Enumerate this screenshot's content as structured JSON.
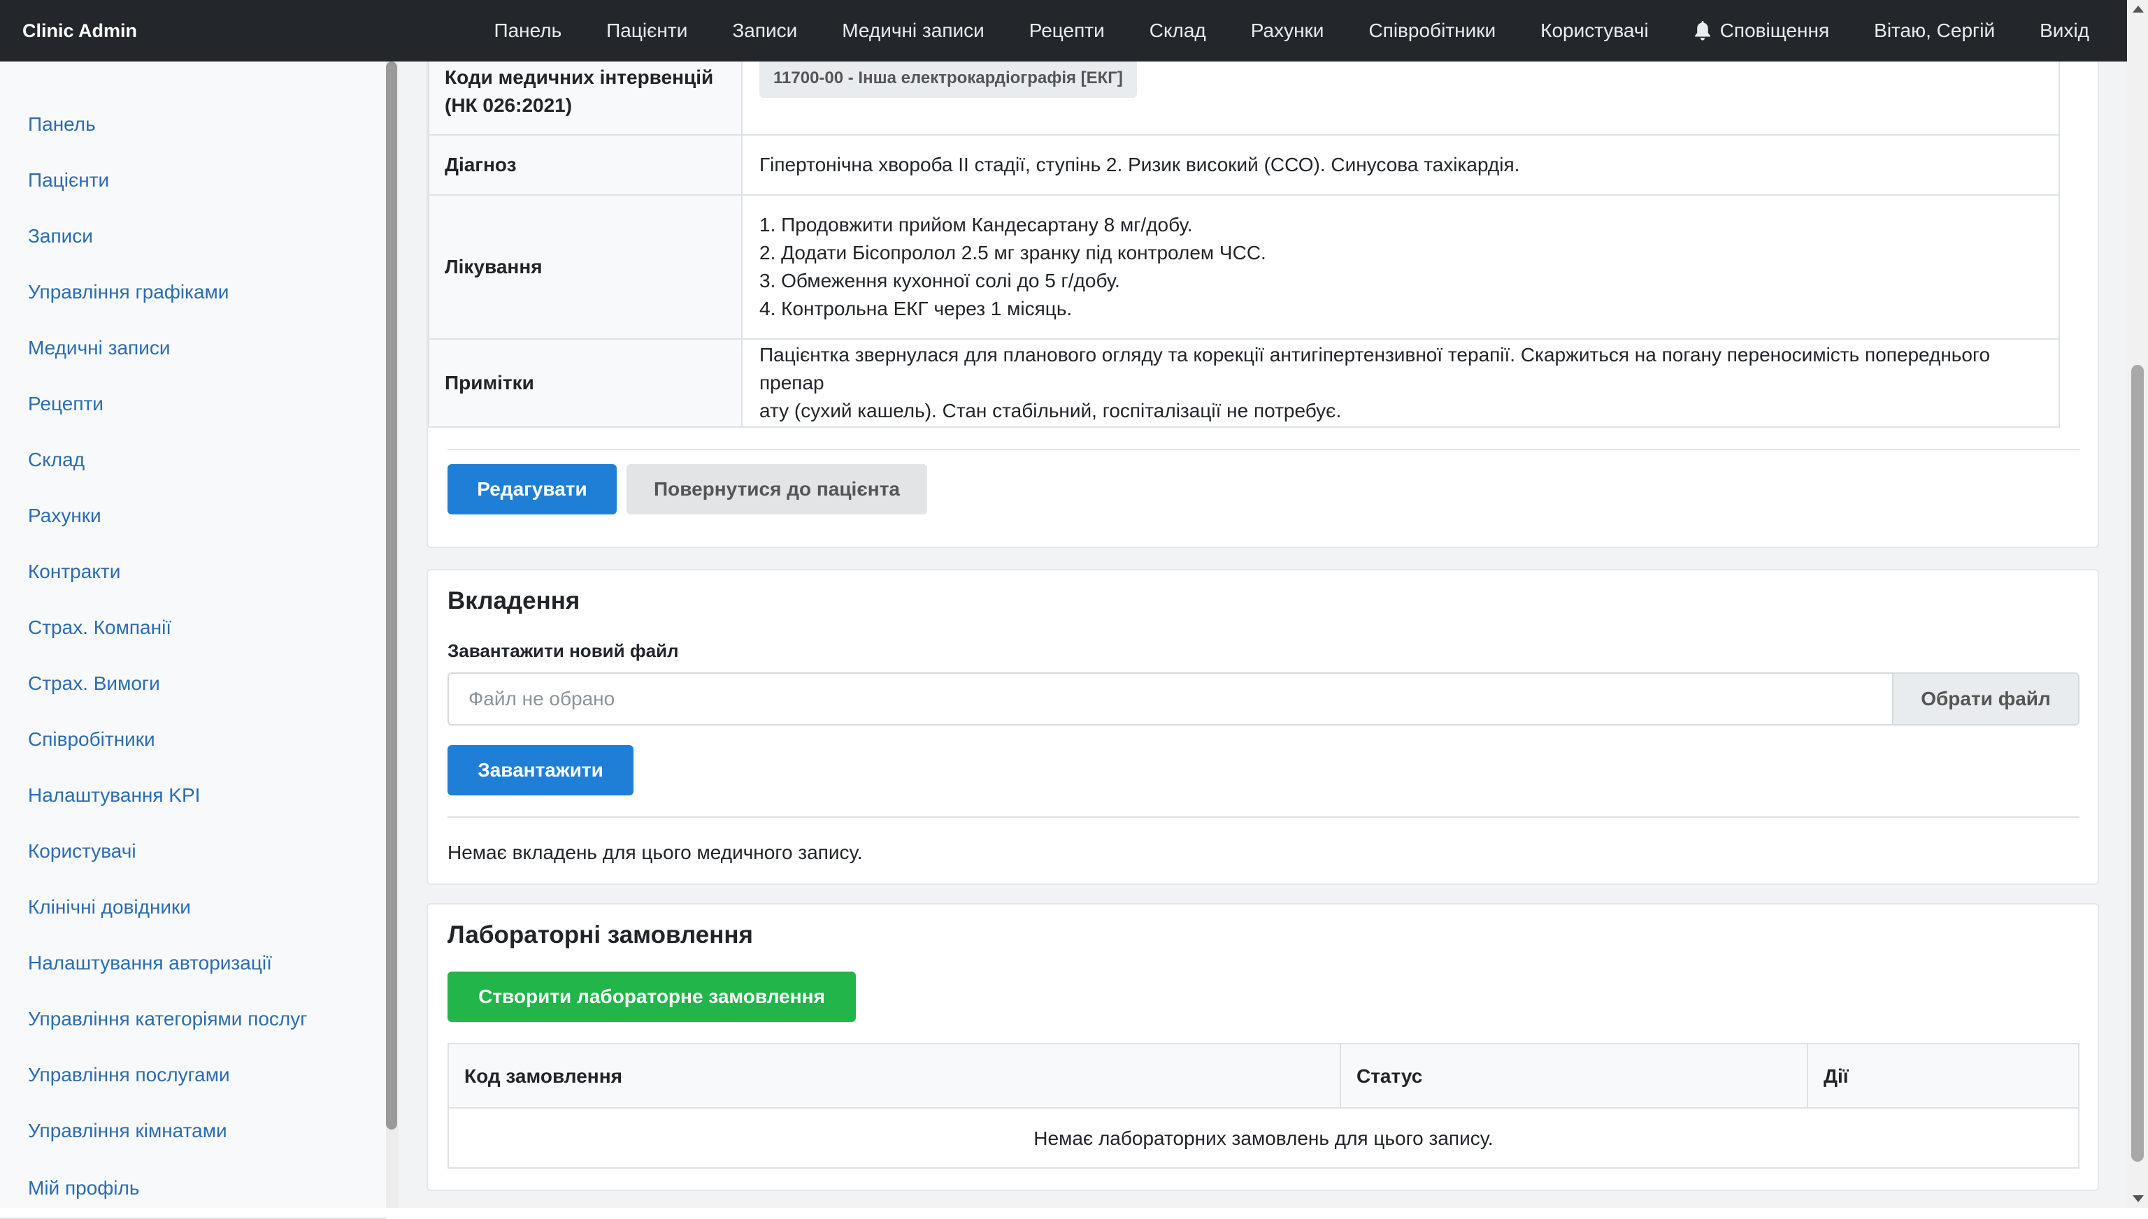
{
  "app": {
    "brand": "Clinic Admin"
  },
  "topnav": {
    "items": [
      "Панель",
      "Пацієнти",
      "Записи",
      "Медичні записи",
      "Рецепти",
      "Склад",
      "Рахунки",
      "Співробітники",
      "Користувачі"
    ],
    "notifications": "Сповіщення",
    "greeting": "Вітаю, Сергій",
    "logout": "Вихід"
  },
  "sidebar": {
    "items": [
      "Панель",
      "Пацієнти",
      "Записи",
      "Управління графіками",
      "Медичні записи",
      "Рецепти",
      "Склад",
      "Рахунки",
      "Контракти",
      "Страх. Компанії",
      "Страх. Вимоги",
      "Співробітники",
      "Налаштування KPI",
      "Користувачі",
      "Клінічні довідники",
      "Налаштування авторизації",
      "Управління категоріями послуг",
      "Управління послугами",
      "Управління кімнатами"
    ],
    "profile": "Мій профіль"
  },
  "record": {
    "codes_label": "Коди медичних інтервенцій (НК 026:2021)",
    "code_badge": "11700-00 - Інша електрокардіографія [ЕКГ]",
    "diagnosis_label": "Діагноз",
    "diagnosis": "Гіпертонічна хвороба II стадії, ступінь 2. Ризик високий (ССО). Синусова тахікардія.",
    "treatment_label": "Лікування",
    "treatment": [
      "1. Продовжити прийом Кандесартану 8 мг/добу.",
      "2. Додати Бісопролол 2.5 мг зранку під контролем ЧСС.",
      "3. Обмеження кухонної солі до 5 г/добу.",
      "4. Контрольна ЕКГ через 1 місяць."
    ],
    "notes_label": "Примітки",
    "notes_line1": "Пацієнтка звернулася для планового огляду та корекції антигіпертензивної терапії. Скаржиться на погану переносимість попереднього препар",
    "notes_line2": "ату (сухий кашель). Стан стабільний, госпіталізації не потребує.",
    "edit_button": "Редагувати",
    "back_button": "Повернутися до пацієнта"
  },
  "attachments": {
    "title": "Вкладення",
    "upload_label": "Завантажити новий файл",
    "file_placeholder": "Файл не обрано",
    "choose_button": "Обрати файл",
    "upload_button": "Завантажити",
    "empty": "Немає вкладень для цього медичного запису."
  },
  "lab": {
    "title": "Лабораторні замовлення",
    "create_button": "Створити лабораторне замовлення",
    "columns": [
      "Код замовлення",
      "Статус",
      "Дії"
    ],
    "empty": "Немає лабораторних замовлень для цього запису."
  },
  "colors": {
    "navbar": "#23272b",
    "primary": "#1f7fd6",
    "success": "#22b54a",
    "link": "#2b6cb0"
  }
}
